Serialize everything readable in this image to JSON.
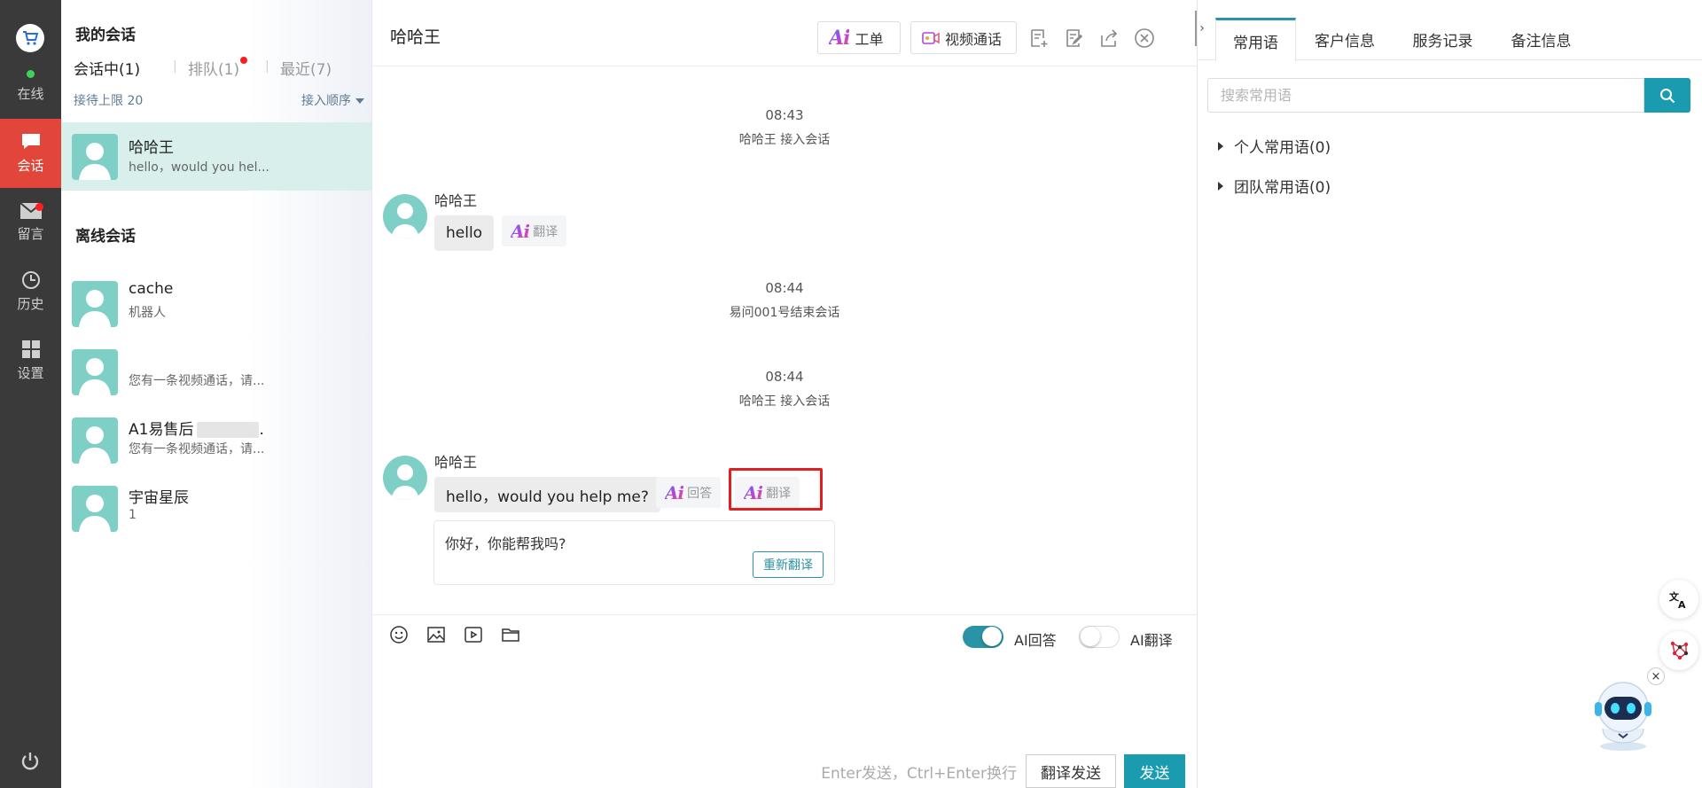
{
  "nav": {
    "status_label": "在线",
    "items": [
      {
        "label": "会话",
        "icon": "chat-bubble-icon",
        "active": true
      },
      {
        "label": "留言",
        "icon": "mail-icon",
        "badge": true
      },
      {
        "label": "历史",
        "icon": "clock-icon"
      },
      {
        "label": "设置",
        "icon": "grid-icon"
      }
    ],
    "accent_color": "#e2453a"
  },
  "conv": {
    "title": "我的会话",
    "tabs": {
      "active": "会话中(1)",
      "queue": "排队(1)",
      "recent": "最近(7)"
    },
    "limit_label": "接待上限 20",
    "order_label": "接入顺序",
    "selected": {
      "name": "哈哈王",
      "preview": "hello，would you hel..."
    },
    "offline_title": "离线会话",
    "offline": [
      {
        "name": "cache",
        "preview": "机器人"
      },
      {
        "name": "",
        "preview": "您有一条视频通话，请..."
      },
      {
        "name": "A1易售后",
        "name_suffix": ".",
        "preview": "您有一条视频通话，请..."
      },
      {
        "name": "宇宙星辰",
        "preview": "1"
      }
    ]
  },
  "chat": {
    "title": "哈哈王",
    "header_buttons": {
      "ticket": "工单",
      "video": "视频通话"
    },
    "ai_logo_text": "Ai",
    "messages": {
      "sys1_time": "08:43",
      "sys1_text": "哈哈王 接入会话",
      "m1_sender": "哈哈王",
      "m1_text": "hello",
      "m1_chip": "翻译",
      "sys2_time": "08:44",
      "sys2_text": "易问001号结束会话",
      "sys3_time": "08:44",
      "sys3_text": "哈哈王 接入会话",
      "m2_sender": "哈哈王",
      "m2_text": "hello，would you help me?",
      "m2_chip_answer": "回答",
      "m2_chip_translate": "翻译",
      "translation": "你好，你能帮我吗?",
      "retranslate": "重新翻译"
    },
    "toolbar": {
      "ai_answer_label": "AI回答",
      "ai_answer_on": true,
      "ai_translate_label": "AI翻译",
      "ai_translate_on": false
    },
    "send_hint": "Enter发送，Ctrl+Enter换行",
    "translate_send": "翻译发送",
    "send": "发送",
    "send_color": "#1a9bb0"
  },
  "right": {
    "tabs": [
      "常用语",
      "客户信息",
      "服务记录",
      "备注信息"
    ],
    "active_tab": "常用语",
    "search_placeholder": "搜索常用语",
    "tree": [
      "个人常用语(0)",
      "团队常用语(0)"
    ]
  }
}
